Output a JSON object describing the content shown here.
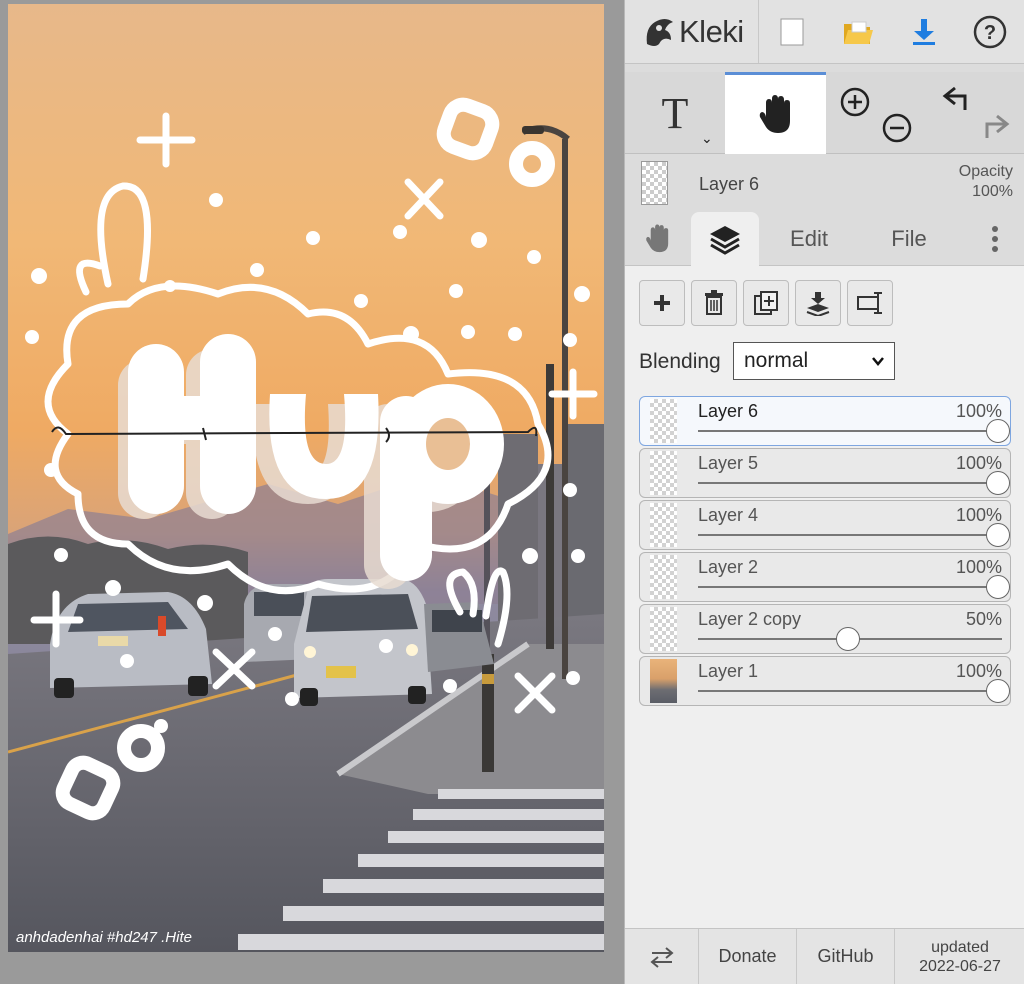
{
  "app": {
    "name": "Kleki",
    "brand_color": "#333333",
    "accent_color": "#5b8ed6"
  },
  "top_bar": {
    "icons": [
      "new-image-icon",
      "open-folder-icon",
      "download-icon",
      "help-icon"
    ]
  },
  "tools": {
    "text_tool_glyph": "T",
    "active_tool": "hand"
  },
  "current_layer": {
    "name": "Layer 6",
    "opacity_label": "Opacity",
    "opacity_value": "100%"
  },
  "tabs": {
    "edit": "Edit",
    "file": "File",
    "active": "layers"
  },
  "blending": {
    "label": "Blending",
    "value": "normal"
  },
  "layers": [
    {
      "name": "Layer 6",
      "opacity": "100%",
      "opacity_value": 1.0,
      "selected": true,
      "thumb": "transparent"
    },
    {
      "name": "Layer 5",
      "opacity": "100%",
      "opacity_value": 1.0,
      "selected": false,
      "thumb": "transparent"
    },
    {
      "name": "Layer 4",
      "opacity": "100%",
      "opacity_value": 1.0,
      "selected": false,
      "thumb": "transparent"
    },
    {
      "name": "Layer 2",
      "opacity": "100%",
      "opacity_value": 1.0,
      "selected": false,
      "thumb": "transparent"
    },
    {
      "name": "Layer 2 copy",
      "opacity": "50%",
      "opacity_value": 0.5,
      "selected": false,
      "thumb": "transparent"
    },
    {
      "name": "Layer 1",
      "opacity": "100%",
      "opacity_value": 1.0,
      "selected": false,
      "thumb": "photo"
    }
  ],
  "footer": {
    "donate": "Donate",
    "github": "GitHub",
    "updated_label": "updated",
    "updated_date": "2022-06-27"
  },
  "canvas": {
    "watermark": "anhdadenhai #hd247 .Hite"
  }
}
